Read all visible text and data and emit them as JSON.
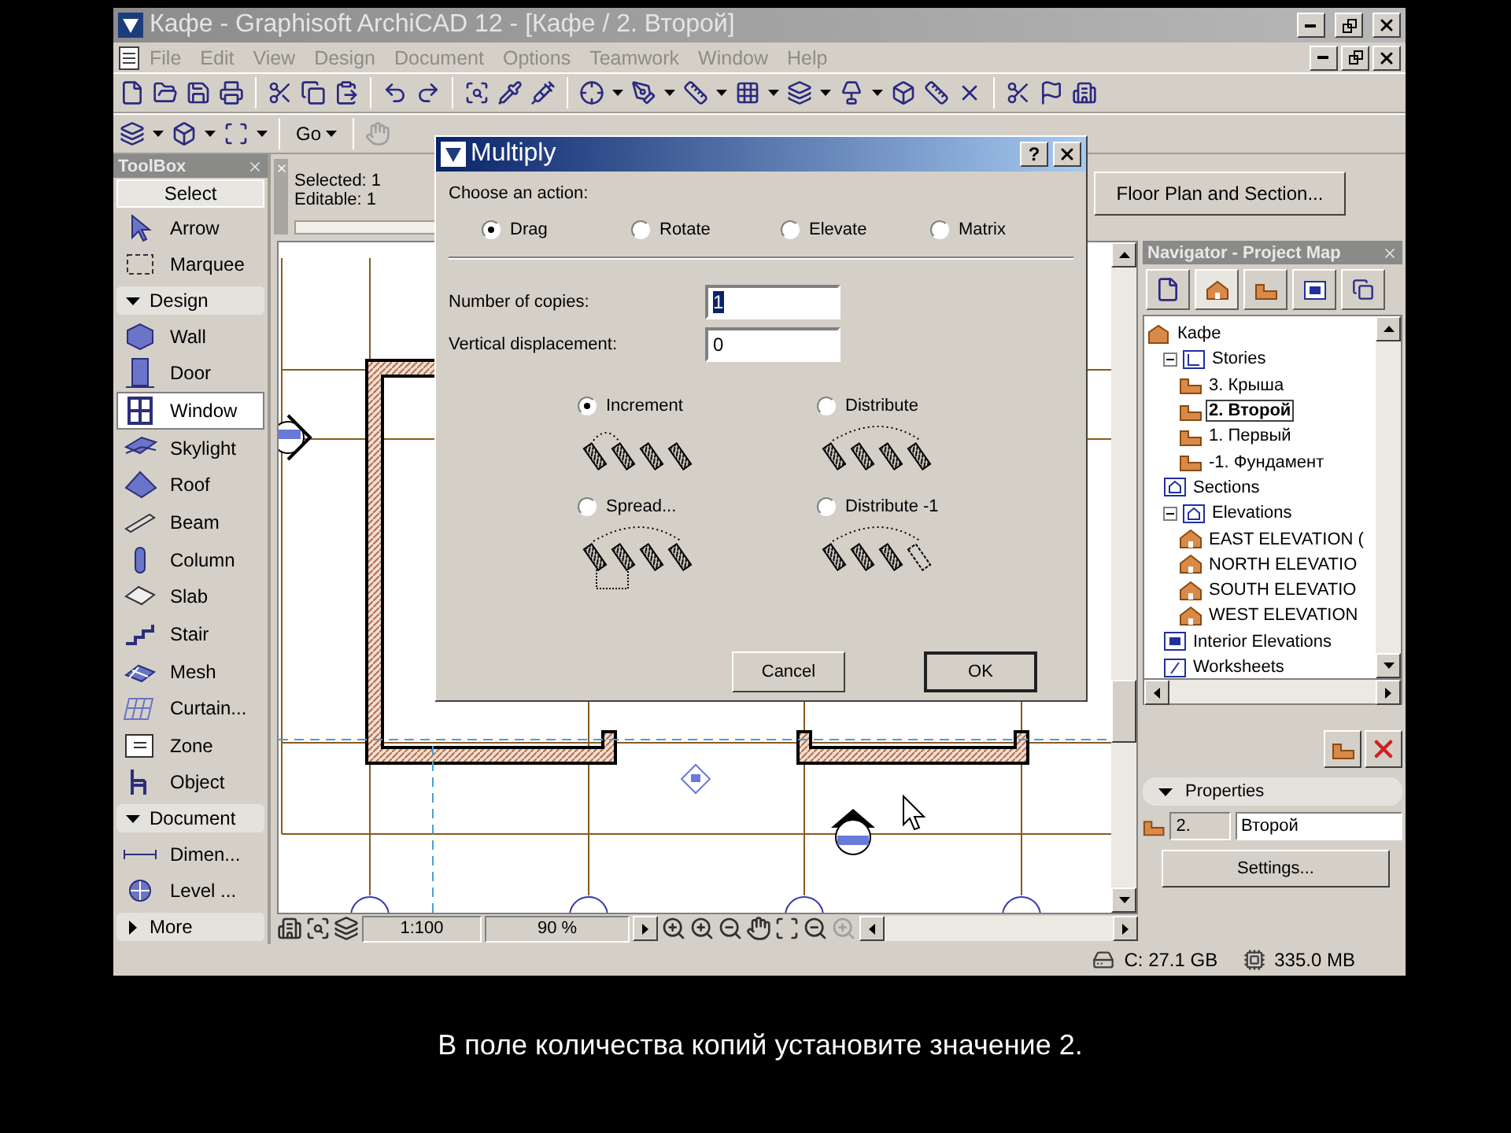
{
  "window": {
    "title": "Кафе - Graphisoft ArchiCAD 12 - [Кафе / 2. Второй]"
  },
  "menu": [
    {
      "label": "File",
      "disabled": true
    },
    {
      "label": "Edit",
      "disabled": true
    },
    {
      "label": "View",
      "disabled": true
    },
    {
      "label": "Design",
      "disabled": true
    },
    {
      "label": "Document",
      "disabled": true
    },
    {
      "label": "Options",
      "disabled": true
    },
    {
      "label": "Teamwork",
      "disabled": true
    },
    {
      "label": "Window",
      "disabled": true
    },
    {
      "label": "Help",
      "disabled": true
    }
  ],
  "toolbar2": {
    "go": "Go"
  },
  "toolbox": {
    "title": "ToolBox",
    "select": "Select",
    "items": [
      {
        "kind": "tool",
        "label": "Arrow",
        "selected": false
      },
      {
        "kind": "tool",
        "label": "Marquee",
        "selected": false
      },
      {
        "kind": "section",
        "label": "Design",
        "expanded": true
      },
      {
        "kind": "tool",
        "label": "Wall",
        "selected": false
      },
      {
        "kind": "tool",
        "label": "Door",
        "selected": false
      },
      {
        "kind": "tool",
        "label": "Window",
        "selected": true
      },
      {
        "kind": "tool",
        "label": "Skylight",
        "selected": false
      },
      {
        "kind": "tool",
        "label": "Roof",
        "selected": false
      },
      {
        "kind": "tool",
        "label": "Beam",
        "selected": false
      },
      {
        "kind": "tool",
        "label": "Column",
        "selected": false
      },
      {
        "kind": "tool",
        "label": "Slab",
        "selected": false
      },
      {
        "kind": "tool",
        "label": "Stair",
        "selected": false
      },
      {
        "kind": "tool",
        "label": "Mesh",
        "selected": false
      },
      {
        "kind": "tool",
        "label": "Curtain...",
        "selected": false
      },
      {
        "kind": "tool",
        "label": "Zone",
        "selected": false
      },
      {
        "kind": "tool",
        "label": "Object",
        "selected": false
      },
      {
        "kind": "section",
        "label": "Document",
        "expanded": true
      },
      {
        "kind": "tool",
        "label": "Dimen...",
        "selected": false
      },
      {
        "kind": "tool",
        "label": "Level ...",
        "selected": false
      },
      {
        "kind": "section",
        "label": "More",
        "expanded": false
      }
    ]
  },
  "info": {
    "selected": "Selected: 1",
    "editable": "Editable: 1",
    "view_button": "Floor Plan and Section..."
  },
  "canvas_bar": {
    "scale": "1:100",
    "zoom": "90 %"
  },
  "navigator": {
    "title": "Navigator - Project Map",
    "tree": [
      {
        "kind": "project",
        "label": "Кафе",
        "selected": false,
        "children": [
          {
            "kind": "storygroup",
            "label": "Stories",
            "selected": false,
            "expanded": true,
            "children": [
              {
                "kind": "story",
                "label": "3. Крыша",
                "selected": false
              },
              {
                "kind": "story",
                "label": "2. Второй",
                "selected": true
              },
              {
                "kind": "story",
                "label": "1. Первый",
                "selected": false
              },
              {
                "kind": "story",
                "label": "-1. Фундамент",
                "selected": false
              }
            ]
          },
          {
            "kind": "sectiongroup",
            "label": "Sections",
            "selected": false
          },
          {
            "kind": "elevationgroup",
            "label": "Elevations",
            "selected": false,
            "expanded": true,
            "children": [
              {
                "kind": "elevation",
                "label": "EAST ELEVATION (",
                "selected": false
              },
              {
                "kind": "elevation",
                "label": "NORTH ELEVATIO",
                "selected": false
              },
              {
                "kind": "elevation",
                "label": "SOUTH ELEVATIO",
                "selected": false
              },
              {
                "kind": "elevation",
                "label": "WEST ELEVATION",
                "selected": false
              }
            ]
          },
          {
            "kind": "interiorgroup",
            "label": "Interior Elevations",
            "selected": false
          },
          {
            "kind": "worksheetgroup",
            "label": "Worksheets",
            "selected": false
          }
        ]
      }
    ],
    "properties": {
      "title": "Properties",
      "expanded": true,
      "id": "2.",
      "name": "Второй",
      "settings": "Settings..."
    }
  },
  "status": {
    "disk": "C: 27.1 GB",
    "memory": "335.0 MB"
  },
  "dialog": {
    "title": "Multiply",
    "help": "?",
    "action_label": "Choose an action:",
    "actions": [
      {
        "label": "Drag",
        "selected": true
      },
      {
        "label": "Rotate",
        "selected": false
      },
      {
        "label": "Elevate",
        "selected": false
      },
      {
        "label": "Matrix",
        "selected": false
      }
    ],
    "fields": [
      {
        "label": "Number of copies:",
        "value": "1",
        "selected": true
      },
      {
        "label": "Vertical displacement:",
        "value": "0",
        "selected": false
      }
    ],
    "methods": [
      {
        "label": "Increment",
        "selected": true
      },
      {
        "label": "Distribute",
        "selected": false
      },
      {
        "label": "Spread...",
        "selected": false
      },
      {
        "label": "Distribute -1",
        "selected": false
      }
    ],
    "buttons": [
      {
        "label": "Cancel",
        "default": false
      },
      {
        "label": "OK",
        "default": true
      }
    ]
  },
  "caption": "В поле количества копий установите значение 2."
}
